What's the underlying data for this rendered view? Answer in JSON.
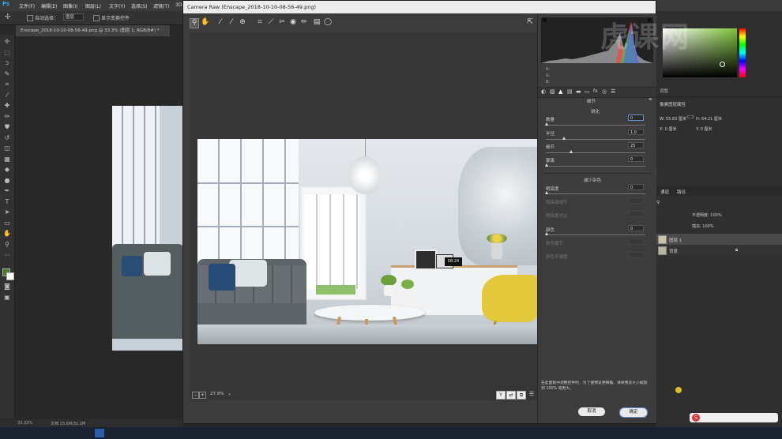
{
  "menubar": {
    "app": "Ps",
    "items": [
      "文件(F)",
      "编辑(E)",
      "图像(I)",
      "图层(L)",
      "文字(Y)",
      "选择(S)",
      "滤镜(T)",
      "3D"
    ]
  },
  "options": {
    "auto_select": "自动选择：",
    "layer_select": "图层",
    "show_transform": "显示变换控件"
  },
  "document": {
    "tab": "Enscape_2018-10-10-08-56-49.png @ 33.3% (图层 1, RGB/8#) *",
    "status_zoom": "33.33%",
    "status_doc": "文档:15.6M/31.2M"
  },
  "camera_raw": {
    "title": "Camera Raw (Enscape_2018-10-10-08-56-49.png)",
    "zoom": "27.9%",
    "clock": "08:24",
    "panel_title": "细节",
    "sharpen": {
      "title": "锐化",
      "items": [
        {
          "label": "数量",
          "value": "0"
        },
        {
          "label": "半径",
          "value": "1.0"
        },
        {
          "label": "细节",
          "value": "25"
        },
        {
          "label": "蒙版",
          "value": "0"
        }
      ]
    },
    "noise": {
      "title": "减少杂色",
      "items": [
        {
          "label": "明亮度",
          "value": "0"
        },
        {
          "label": "明亮度细节",
          "value": ""
        },
        {
          "label": "明亮度对比",
          "value": ""
        },
        {
          "label": "颜色",
          "value": "0"
        },
        {
          "label": "颜色细节",
          "value": ""
        },
        {
          "label": "颜色平滑度",
          "value": ""
        }
      ]
    },
    "hint": "在此面板中调整控件时，为了使预览更精确，请将预览大小缩放到 100% 或更大。",
    "cancel": "取消",
    "ok": "确定"
  },
  "right_panel": {
    "adjust": "调整",
    "props_title": "像素图层属性",
    "w": "W: 55.83 厘米",
    "h": "H: 64.21 厘米",
    "x": "X: 0 厘米",
    "y": "Y: 0 厘米",
    "tabs": [
      "通道",
      "路径"
    ],
    "opacity": "不透明度: 100%",
    "fill": "填充: 100%",
    "layers": [
      {
        "name": "图层 1"
      },
      {
        "name": "背景"
      }
    ]
  },
  "watermark": "虎课网",
  "colors": {
    "accent": "#31a8ff",
    "sofa": "#5c6468",
    "chair": "#e2c83a"
  }
}
